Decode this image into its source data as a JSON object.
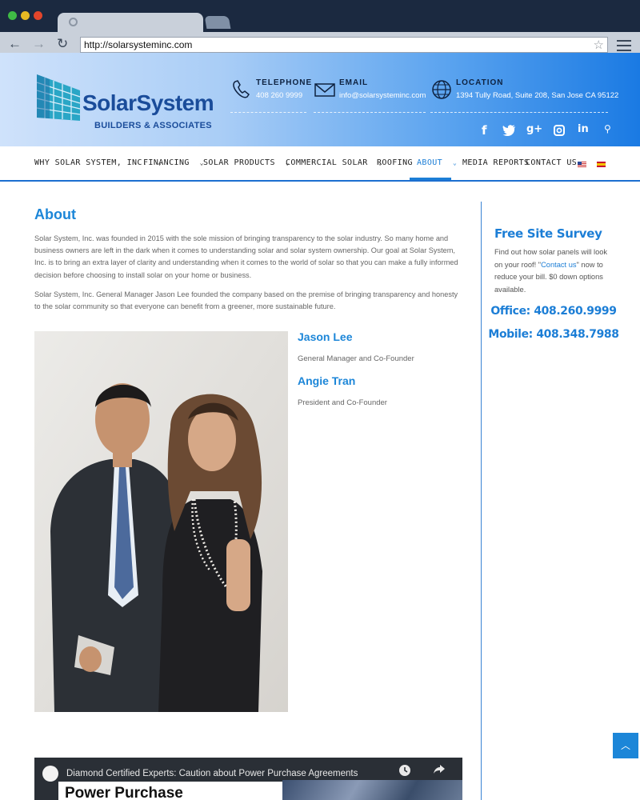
{
  "browser": {
    "url": "http://solarsysteminc.com"
  },
  "header": {
    "logo_title": "SolarSystem",
    "logo_subtitle": "BUILDERS & ASSOCIATES",
    "telephone_label": "TELEPHONE",
    "telephone_value": "408 260 9999",
    "email_label": "EMAIL",
    "email_value": "info@solarsysteminc.com",
    "location_label": "LOCATION",
    "location_value": "1394 Tully Road, Suite 208, San Jose CA 95122",
    "social": [
      "facebook-icon",
      "twitter-icon",
      "google-plus-icon",
      "instagram-icon",
      "linkedin-icon",
      "search-icon"
    ]
  },
  "nav": {
    "items": [
      {
        "label": "WHY SOLAR SYSTEM, INC."
      },
      {
        "label": "FINANCING"
      },
      {
        "label": "SOLAR PRODUCTS"
      },
      {
        "label": "COMMERCIAL SOLAR"
      },
      {
        "label": "ROOFING"
      },
      {
        "label": "ABOUT"
      },
      {
        "label": "MEDIA REPORTS"
      },
      {
        "label": "CONTACT US"
      }
    ],
    "active": "ABOUT"
  },
  "main": {
    "title": "About",
    "paragraph1": "Solar System, Inc. was founded in 2015 with the sole mission of bringing transparency to the solar industry. So many home and business owners are left in the dark when it comes to understanding solar and solar system ownership. Our goal at Solar System, Inc. is to bring an extra layer of clarity and understanding when it comes to the world of solar so that you can make a fully informed decision before choosing to install solar on your home or business.",
    "paragraph2": "Solar System, Inc. General Manager Jason Lee founded the company based on the premise of bringing transparency and honesty to the solar community so that everyone can benefit from a greener, more sustainable future.",
    "people": [
      {
        "name": "Jason Lee",
        "role": "General Manager and Co-Founder"
      },
      {
        "name": "Angie Tran",
        "role": "President and Co-Founder"
      }
    ],
    "video_title": "Diamond Certified Experts: Caution about Power Purchase Agreements",
    "video_overlay": "Power Purchase"
  },
  "sidebar": {
    "title": "Free Site Survey",
    "text_before": "Find out how solar panels will look on your roof! \"",
    "link": "Contact us",
    "text_after": "\" now to reduce your bill. $0 down options available.",
    "office": "Office: 408.260.9999",
    "mobile": "Mobile: 408.348.7988"
  },
  "colors": {
    "accent": "#1c7ed6",
    "header_gradient_end": "#1a7ae3"
  }
}
